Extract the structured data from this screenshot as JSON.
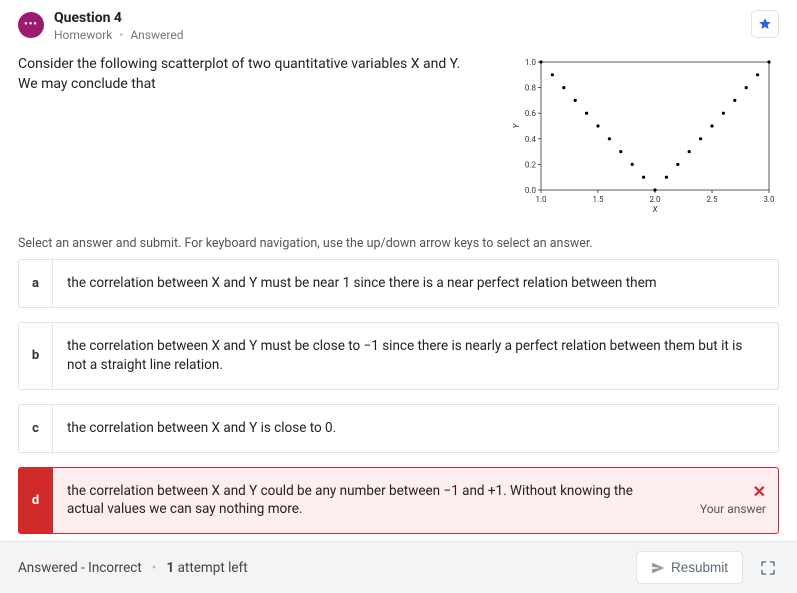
{
  "header": {
    "title": "Question 4",
    "type": "Homework",
    "status": "Answered"
  },
  "prompt": {
    "line1": "Consider the following scatterplot of two quantitative variables X and Y.",
    "line2": "We may conclude that"
  },
  "instruction": "Select an answer and submit. For keyboard navigation, use the up/down arrow keys to select an answer.",
  "options": {
    "a": {
      "letter": "a",
      "text": "the correlation between X and Y must be near 1 since there is a near perfect relation between them"
    },
    "b": {
      "letter": "b",
      "text": "the correlation between X and Y must be close to −1 since there is nearly a perfect relation between them but it is not a straight line relation."
    },
    "c": {
      "letter": "c",
      "text": "the correlation between X and Y is close to 0."
    },
    "d": {
      "letter": "d",
      "text": "the correlation between X and Y could be any number between −1 and +1. Without knowing the actual values we can say nothing more."
    }
  },
  "selected_feedback": {
    "mark": "✕",
    "label": "Your answer"
  },
  "footer": {
    "status": "Answered - Incorrect",
    "attempts_num": "1",
    "attempts_suffix": " attempt left",
    "resubmit": "Resubmit"
  },
  "chart_data": {
    "type": "scatter",
    "title": "",
    "xlabel": "X",
    "ylabel": "Y",
    "xlim": [
      1.0,
      3.0
    ],
    "ylim": [
      0.0,
      1.0
    ],
    "xticks": [
      1.0,
      1.5,
      2.0,
      2.5,
      3.0
    ],
    "yticks": [
      0.0,
      0.2,
      0.4,
      0.6,
      0.8,
      1.0
    ],
    "x": [
      1.0,
      1.1,
      1.2,
      1.3,
      1.4,
      1.5,
      1.6,
      1.7,
      1.8,
      1.9,
      2.0,
      2.1,
      2.2,
      2.3,
      2.4,
      2.5,
      2.6,
      2.7,
      2.8,
      2.9,
      3.0
    ],
    "y": [
      1.0,
      0.9,
      0.8,
      0.7,
      0.6,
      0.5,
      0.4,
      0.3,
      0.2,
      0.1,
      0.0,
      0.1,
      0.2,
      0.3,
      0.4,
      0.5,
      0.6,
      0.7,
      0.8,
      0.9,
      1.0
    ]
  }
}
